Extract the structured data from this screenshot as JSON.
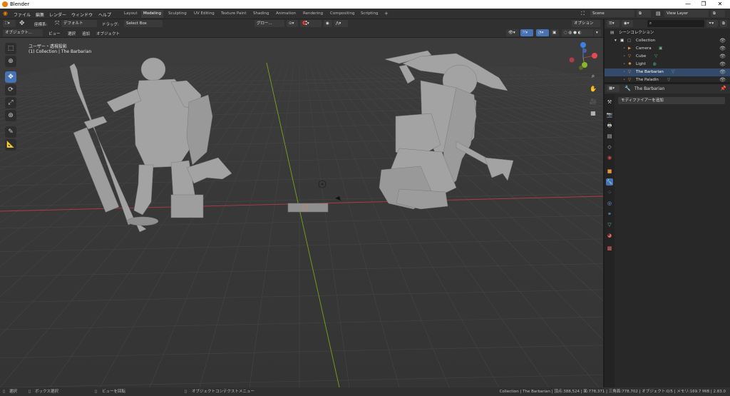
{
  "window": {
    "title": "Blender",
    "controls": [
      "—",
      "❐",
      "✕"
    ]
  },
  "menu": [
    "ファイル",
    "編集",
    "レンダー",
    "ウィンドウ",
    "ヘルプ"
  ],
  "workspaces": [
    "Layout",
    "Modeling",
    "Sculpting",
    "UV Editing",
    "Texture Paint",
    "Shading",
    "Animation",
    "Rendering",
    "Compositing",
    "Scripting",
    "+"
  ],
  "active_workspace": "Modeling",
  "scene": {
    "name": "Scene",
    "view_layer": "View Layer"
  },
  "header": {
    "orientation_label": "座標系:",
    "orientation_value": "デフォルト",
    "drag_label": "ドラッグ:",
    "drag_value": "Select Box",
    "transform_label": "グロー...",
    "options": "オプション"
  },
  "header2": {
    "mode": "オブジェクト...",
    "view": "ビュー",
    "select": "選択",
    "add": "追加",
    "object": "オブジェクト"
  },
  "viewport_info": {
    "line1": "ユーザー・透視投影",
    "line2": "(1) Collection | The Barbarian"
  },
  "outliner": {
    "search_placeholder": "",
    "root": "シーンコレクション",
    "collection": "Collection",
    "items": [
      "Camera",
      "Cube",
      "Light",
      "The Barbarian",
      "The Paladin"
    ]
  },
  "properties": {
    "object": "The Barbarian",
    "add_modifier": "モディファイアーを追加"
  },
  "status": {
    "select": "選択",
    "box_select": "ボックス選択",
    "rotate_view": "ビューを回転",
    "context_menu": "オブジェクトコンテクストメニュー",
    "stats": "Collection | The Barbarian | 頂点:388,524 | 面:778,371 | 三角面:778,702 | オブジェクト:0/5 | メモリ:169.7 MiB | 2.83.0"
  },
  "colors": {
    "accent": "#4772b3",
    "x_axis": "#b33b47",
    "y_axis": "#7aa11f",
    "z_axis": "#3d7fe6",
    "grid": "#454545",
    "mesh": "#a3a3a3"
  }
}
